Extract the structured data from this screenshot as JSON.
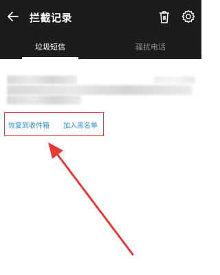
{
  "header": {
    "title": "拦截记录",
    "back_icon": "back-arrow-icon",
    "delete_icon": "trash-icon",
    "settings_icon": "gear-icon"
  },
  "tabs": [
    {
      "label": "垃圾短信",
      "active": true
    },
    {
      "label": "骚扰电话",
      "active": false
    }
  ],
  "message": {
    "sender": "",
    "time": "",
    "body": ""
  },
  "actions": {
    "restore_label": "恢复到收件箱",
    "blacklist_label": "加入黑名单"
  },
  "colors": {
    "bar": "#1c1c1c",
    "accent": "#2f8fd6",
    "annotation": "#e53935"
  }
}
